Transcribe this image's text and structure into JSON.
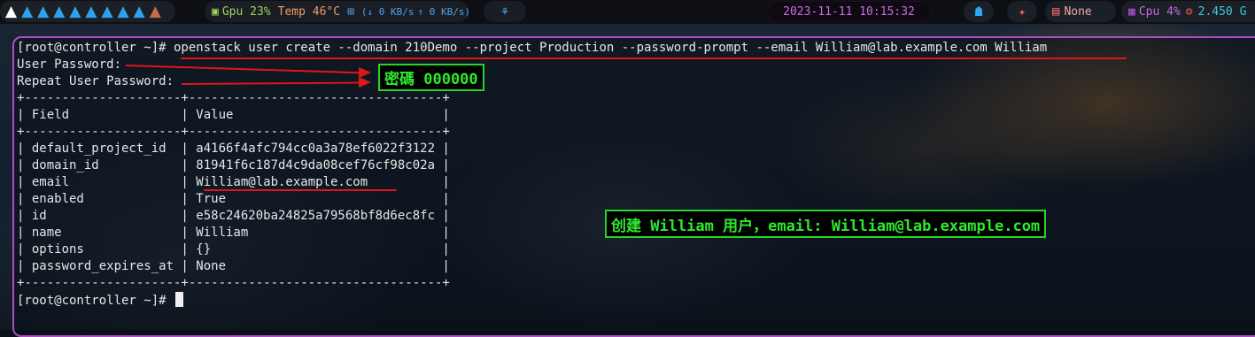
{
  "topbar": {
    "workspaces": [
      "A",
      "A",
      "A",
      "A",
      "A",
      "A",
      "A",
      "A",
      "A",
      "A"
    ],
    "gpu": "Gpu 23%",
    "temp": "Temp 46°C",
    "net_down": "↓ 0 KB/s",
    "net_up": "↑ 0 KB/s",
    "datetime": "2023-11-11 10:15:32",
    "memory": "None",
    "cpu": "Cpu 4%",
    "cpu_freq": "2.450 G"
  },
  "terminal": {
    "lines": [
      "[root@controller ~]# openstack user create --domain 210Demo --project Production --password-prompt --email William@lab.example.com William",
      "User Password:",
      "Repeat User Password:",
      "+---------------------+----------------------------------+",
      "| Field               | Value                            |",
      "+---------------------+----------------------------------+",
      "| default_project_id  | a4166f4afc794cc0a3a78ef6022f3122 |",
      "| domain_id           | 81941f6c187d4c9da08cef76cf98c02a |",
      "| email               | William@lab.example.com          |",
      "| enabled             | True                             |",
      "| id                  | e58c24620ba24825a79568bf8d6ec8fc |",
      "| name                | William                          |",
      "| options             | {}                               |",
      "| password_expires_at | None                             |",
      "+---------------------+----------------------------------+",
      "[root@controller ~]# "
    ]
  },
  "annotations": {
    "password_note": "密碼 000000",
    "create_note": "创建 William 用户，email: William@lab.example.com"
  },
  "colors": {
    "terminal_border": "#b04cc2",
    "annotation_red": "#e3141a",
    "annotation_green": "#2fe82f"
  }
}
